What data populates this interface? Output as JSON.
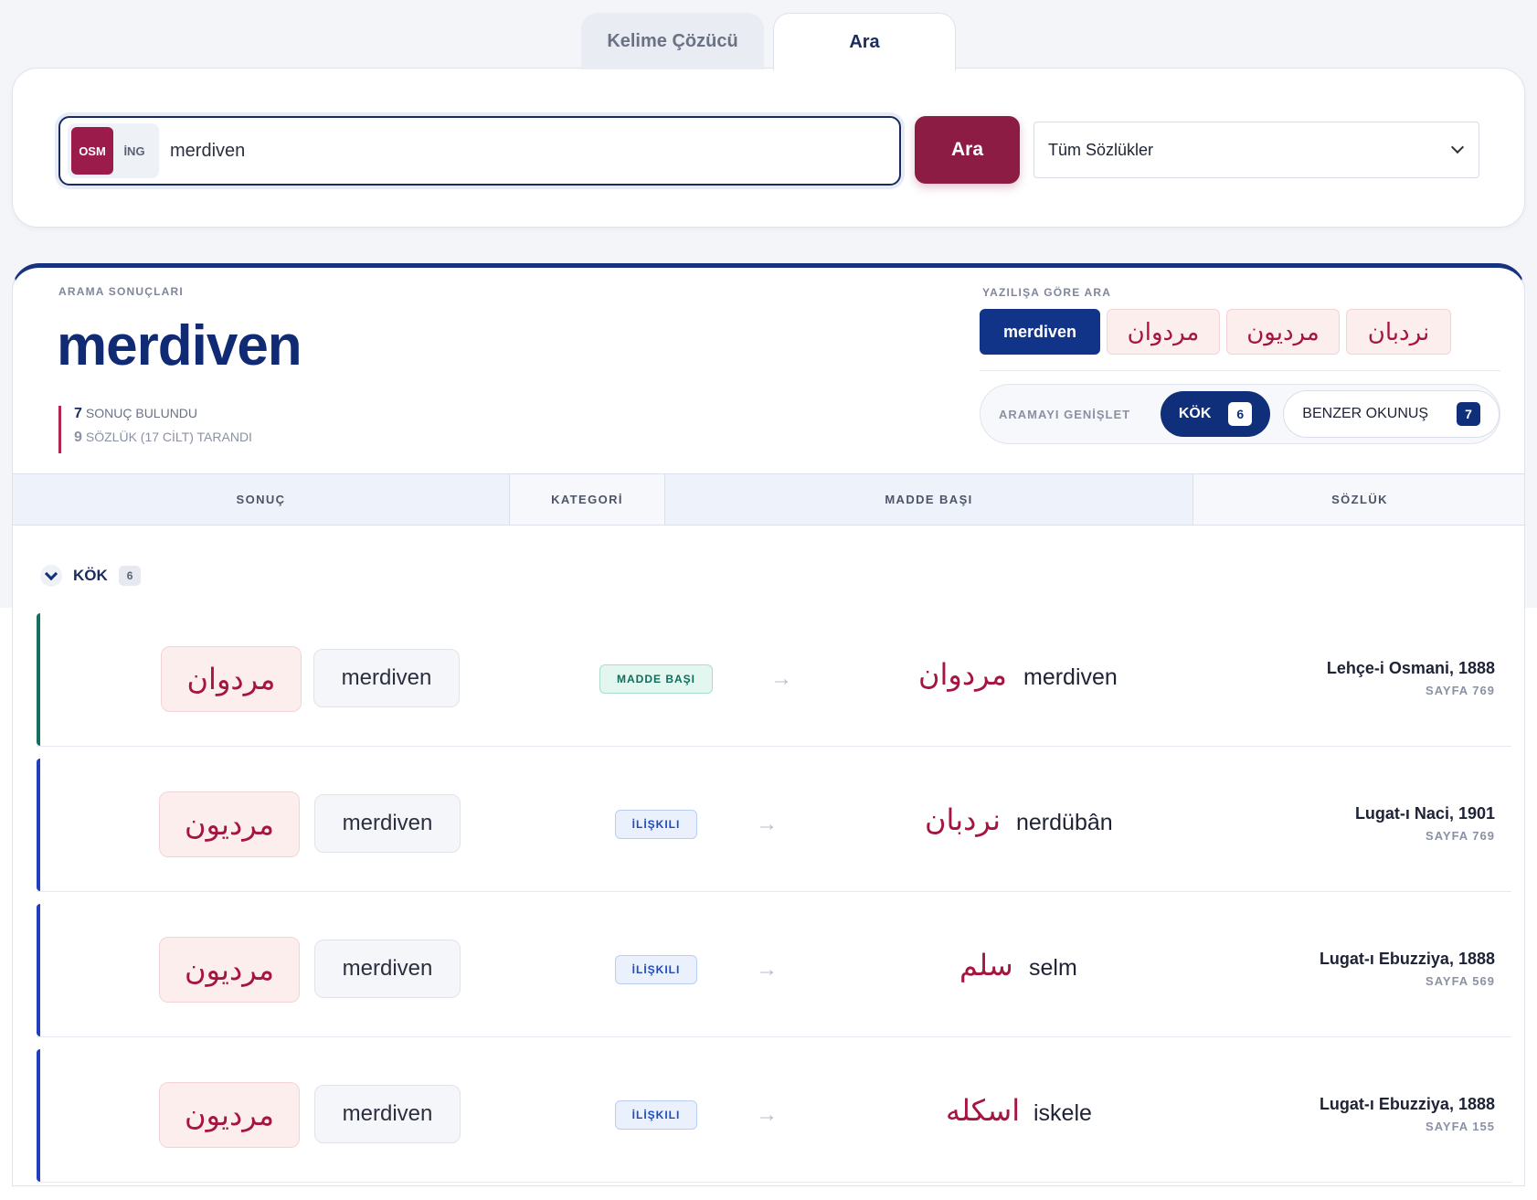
{
  "tabs": [
    "Kelime Çözücü",
    "Ara"
  ],
  "search": {
    "lang_osm": "OSM",
    "lang_ing": "İNG",
    "query": "merdiven",
    "button": "Ara",
    "dictionary_select": "Tüm Sözlükler"
  },
  "results": {
    "eyebrow": "ARAMA SONUÇLARI",
    "title": "merdiven",
    "result_count": "7",
    "result_count_label": "SONUÇ BULUNDU",
    "dict_count": "9",
    "dict_count_label": "SÖZLÜK (17 CİLT) TARANDI",
    "script_label": "YAZILIŞA GÖRE ARA",
    "scripts": [
      "merdiven",
      "مردوان",
      "مرديون",
      "نردبان"
    ],
    "expand_label": "ARAMAYI GENİŞLET",
    "kok_label": "KÖK",
    "kok_count": "6",
    "benzer_label": "BENZER OKUNUŞ",
    "benzer_count": "7"
  },
  "table": {
    "headers": [
      "SONUÇ",
      "KATEGORİ",
      "MADDE BAŞI",
      "SÖZLÜK"
    ],
    "group": {
      "title": "KÖK",
      "count": "6"
    },
    "rows": [
      {
        "ar": "مردوان",
        "lat": "merdiven",
        "category": "MADDE BAŞI",
        "head_ar": "مردوان",
        "head_lat": "merdiven",
        "dict": "Lehçe-i Osmani, 1888",
        "page": "SAYFA 769"
      },
      {
        "ar": "مرديون",
        "lat": "merdiven",
        "category": "İLİŞKILI",
        "head_ar": "نردبان",
        "head_lat": "nerdübân",
        "dict": "Lugat-ı Naci, 1901",
        "page": "SAYFA 769"
      },
      {
        "ar": "مرديون",
        "lat": "merdiven",
        "category": "İLİŞKILI",
        "head_ar": "سلم",
        "head_lat": "selm",
        "dict": "Lugat-ı Ebuzziya, 1888",
        "page": "SAYFA 569"
      },
      {
        "ar": "مرديون",
        "lat": "merdiven",
        "category": "İLİŞKILI",
        "head_ar": "اسكله",
        "head_lat": "iskele",
        "dict": "Lugat-ı Ebuzziya, 1888",
        "page": "SAYFA 155"
      }
    ],
    "arrow": "→"
  }
}
